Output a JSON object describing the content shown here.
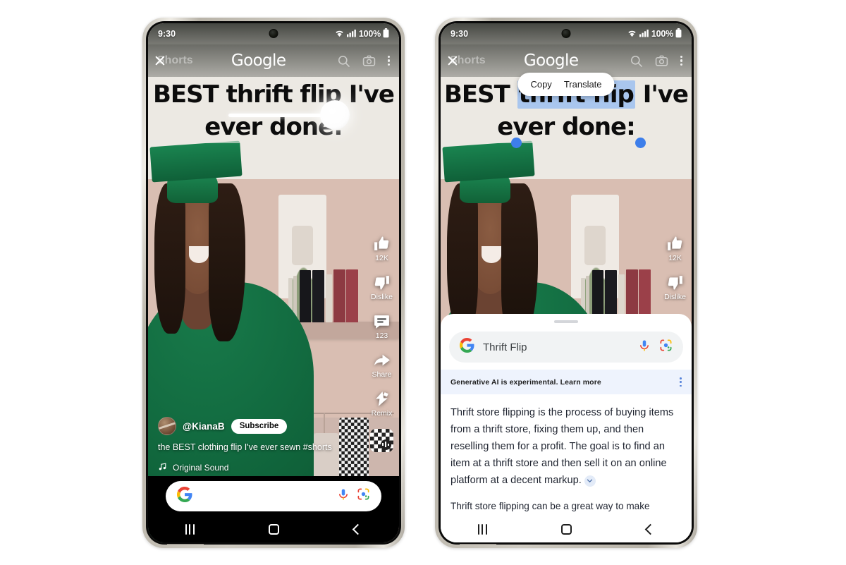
{
  "phones": [
    {
      "id": "left",
      "status": {
        "time": "9:30",
        "battery": "100%",
        "wifi_icon": "wifi-icon",
        "signal_icon": "signal-icon",
        "battery_icon": "battery-icon"
      },
      "appbar": {
        "shorts_label": "Shorts",
        "close_icon": "close-icon",
        "logo": "Google",
        "search_icon": "search-icon",
        "camera_icon": "camera-icon",
        "more_icon": "kebab-menu-icon"
      },
      "overlay_lines": [
        "BEST thrift flip I've",
        "ever done:"
      ],
      "gesture": {
        "type": "circle-to-search-scribble"
      },
      "actions": [
        {
          "icon": "thumbs-up-icon",
          "label": "12K"
        },
        {
          "icon": "thumbs-down-icon",
          "label": "Dislike"
        },
        {
          "icon": "comment-icon",
          "label": "123"
        },
        {
          "icon": "share-icon",
          "label": "Share"
        },
        {
          "icon": "remix-icon",
          "label": "Remix"
        },
        {
          "icon": "sound-disc-icon",
          "label": ""
        }
      ],
      "channel": {
        "handle": "@KianaB",
        "subscribe_label": "Subscribe",
        "caption": "the BEST clothing flip I've ever sewn #shorts",
        "sound_label": "Original Sound",
        "music_icon": "music-note-icon"
      },
      "search_dock": {
        "google_icon": "google-g-icon",
        "mic_icon": "microphone-icon",
        "lens_icon": "google-lens-icon",
        "value": ""
      },
      "navbar": {
        "recents": "recents-icon",
        "home": "home-icon",
        "back": "back-icon"
      }
    },
    {
      "id": "right",
      "status": {
        "time": "9:30",
        "battery": "100%",
        "wifi_icon": "wifi-icon",
        "signal_icon": "signal-icon",
        "battery_icon": "battery-icon"
      },
      "appbar": {
        "shorts_label": "Shorts",
        "close_icon": "close-icon",
        "logo": "Google",
        "search_icon": "search-icon",
        "camera_icon": "camera-icon",
        "more_icon": "kebab-menu-icon"
      },
      "overlay_lines": [
        "BEST thrift flip I've",
        "ever done:"
      ],
      "selection": {
        "selected_text": "thrift flip",
        "highlight_color": "#a9c6ee",
        "handle_color": "#3d7eea"
      },
      "context_menu": {
        "items": [
          "Copy",
          "Translate"
        ]
      },
      "actions": [
        {
          "icon": "thumbs-up-icon",
          "label": "12K"
        },
        {
          "icon": "thumbs-down-icon",
          "label": "Dislike"
        }
      ],
      "sheet": {
        "search": {
          "google_icon": "google-g-icon",
          "query": "Thrift Flip",
          "mic_icon": "microphone-icon",
          "lens_icon": "google-lens-icon"
        },
        "banner": {
          "text": "Generative AI is experimental.",
          "link": "Learn more",
          "more_icon": "kebab-menu-icon",
          "background": "#eef3fd"
        },
        "answer_paragraph": "Thrift store flipping is the process of buying items from a thrift store, fixing them up, and then reselling them for a profit. The goal is to find an item at a thrift store and then sell it on an online platform at a decent markup.",
        "expand_icon": "chevron-down-icon",
        "answer_paragraph_2": "Thrift store flipping can be a great way to make"
      },
      "navbar": {
        "recents": "recents-icon",
        "home": "home-icon",
        "back": "back-icon"
      }
    }
  ],
  "colors": {
    "page_background": "#ffffff",
    "frame": "#cfcbc2",
    "selection_blue": "#a9c6ee",
    "banner_blue": "#eef3fd",
    "google_blue": "#4285F4",
    "google_red": "#EA4335",
    "google_yellow": "#FBBC05",
    "google_green": "#34A853"
  }
}
